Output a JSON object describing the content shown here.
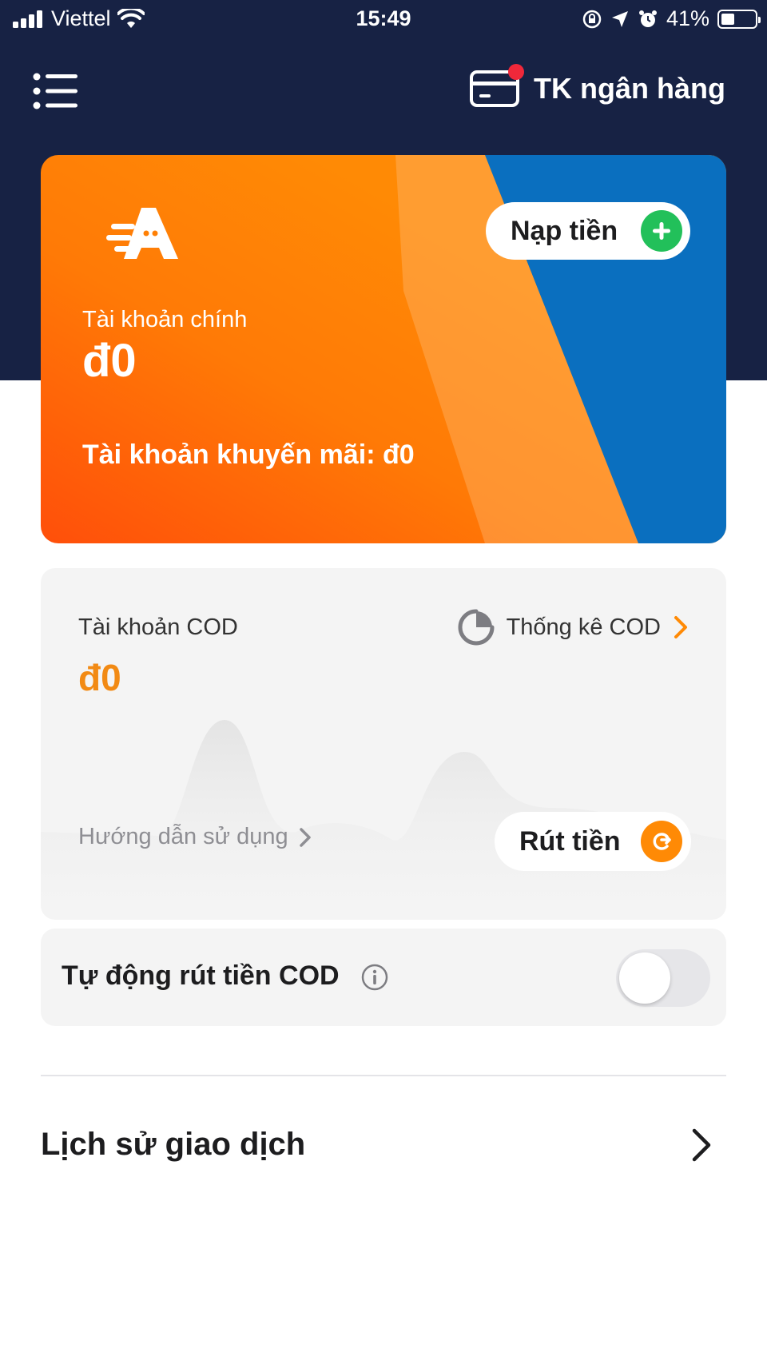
{
  "status_bar": {
    "carrier": "Viettel",
    "time": "15:49",
    "battery": "41%",
    "battery_level": 0.41
  },
  "header": {
    "bank_account_label": "TK ngân hàng"
  },
  "main_card": {
    "topup_label": "Nạp tiền",
    "main_account_label": "Tài khoản chính",
    "main_account_balance": "đ0",
    "promo_account_text": "Tài khoản khuyến mãi: đ0"
  },
  "cod_card": {
    "label": "Tài khoản COD",
    "balance": "đ0",
    "stats_label": "Thống kê COD",
    "guide_label": "Hướng dẫn sử dụng",
    "withdraw_label": "Rút tiền"
  },
  "auto_withdraw": {
    "label": "Tự động rút tiền COD",
    "enabled": false
  },
  "history": {
    "label": "Lịch sử giao dịch"
  },
  "colors": {
    "navy": "#172244",
    "orange": "#ff8a05",
    "blue": "#0a6fbf",
    "green": "#22c05a",
    "cod_amount": "#f28a14"
  },
  "icons": [
    "signal-icon",
    "wifi-icon",
    "lock-rotation-icon",
    "location-icon",
    "alarm-icon",
    "battery-icon",
    "menu-icon",
    "card-icon",
    "logo-icon",
    "plus-icon",
    "pie-chart-icon",
    "chevron-right-icon",
    "refresh-icon",
    "info-icon"
  ]
}
